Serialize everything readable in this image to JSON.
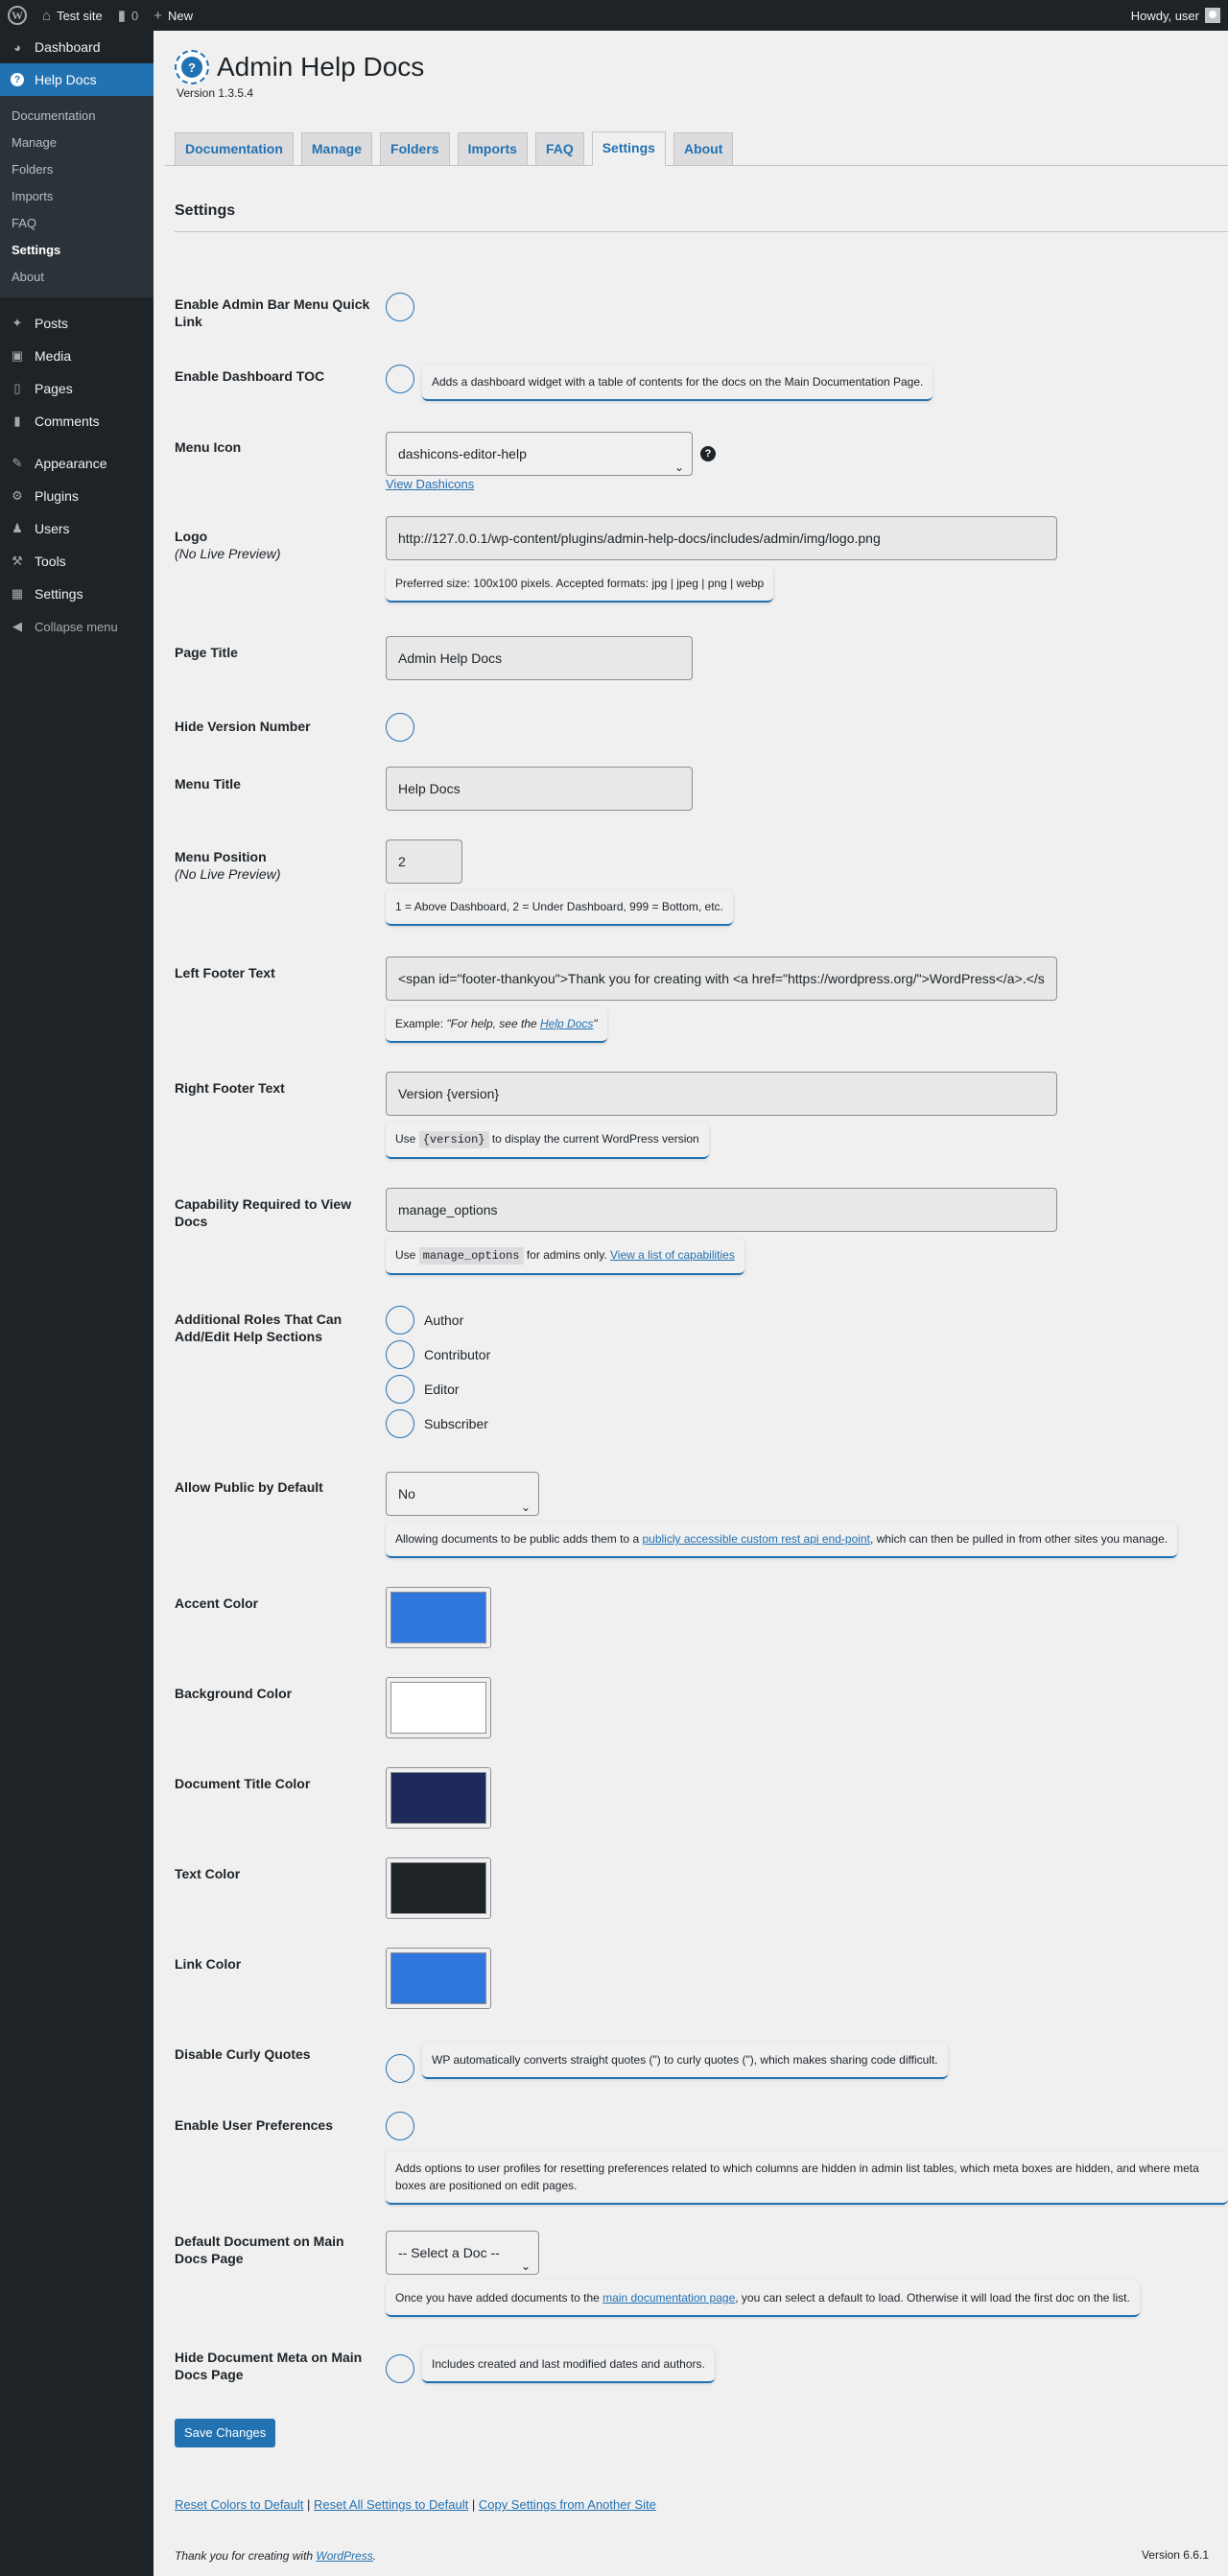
{
  "adminbar": {
    "site_name": "Test site",
    "comments_count": "0",
    "new_label": "New",
    "howdy": "Howdy, user"
  },
  "sidebar": {
    "items_top": [
      {
        "label": "Dashboard",
        "icon": "dashboard-icon"
      },
      {
        "label": "Help Docs",
        "icon": "help-icon"
      }
    ],
    "submenu": [
      "Documentation",
      "Manage",
      "Folders",
      "Imports",
      "FAQ",
      "Settings",
      "About"
    ],
    "items_mid": [
      {
        "label": "Posts",
        "icon": "pin-icon"
      },
      {
        "label": "Media",
        "icon": "media-icon"
      },
      {
        "label": "Pages",
        "icon": "pages-icon"
      },
      {
        "label": "Comments",
        "icon": "comments-icon"
      }
    ],
    "items_bottom": [
      {
        "label": "Appearance",
        "icon": "brush-icon"
      },
      {
        "label": "Plugins",
        "icon": "plugin-icon"
      },
      {
        "label": "Users",
        "icon": "users-icon"
      },
      {
        "label": "Tools",
        "icon": "wrench-icon"
      },
      {
        "label": "Settings",
        "icon": "settings-icon"
      }
    ],
    "collapse": "Collapse menu"
  },
  "header": {
    "title": "Admin Help Docs",
    "version": "Version 1.3.5.4"
  },
  "tabs": [
    "Documentation",
    "Manage",
    "Folders",
    "Imports",
    "FAQ",
    "Settings",
    "About"
  ],
  "section_title": "Settings",
  "settings": {
    "admin_bar": {
      "label": "Enable Admin Bar Menu Quick Link"
    },
    "dashboard_toc": {
      "label": "Enable Dashboard TOC",
      "help": "Adds a dashboard widget with a table of contents for the docs on the Main Documentation Page."
    },
    "menu_icon": {
      "label": "Menu Icon",
      "value": "dashicons-editor-help",
      "link": "View Dashicons"
    },
    "logo": {
      "label": "Logo",
      "sub": "(No Live Preview)",
      "value": "http://127.0.0.1/wp-content/plugins/admin-help-docs/includes/admin/img/logo.png",
      "help": "Preferred size: 100x100 pixels. Accepted formats: jpg | jpeg | png | webp"
    },
    "page_title": {
      "label": "Page Title",
      "value": "Admin Help Docs"
    },
    "hide_version": {
      "label": "Hide Version Number"
    },
    "menu_title": {
      "label": "Menu Title",
      "value": "Help Docs"
    },
    "menu_position": {
      "label": "Menu Position",
      "sub": "(No Live Preview)",
      "value": "2",
      "help": "1 = Above Dashboard, 2 = Under Dashboard, 999 = Bottom, etc."
    },
    "left_footer": {
      "label": "Left Footer Text",
      "value": "<span id=\"footer-thankyou\">Thank you for creating with <a href=\"https://wordpress.org/\">WordPress</a>.</s",
      "help_prefix": "Example: ",
      "help_quote_a": "\"For help, see the ",
      "help_link": "Help Docs",
      "help_quote_b": "\""
    },
    "right_footer": {
      "label": "Right Footer Text",
      "value": "Version {version}",
      "help_a": "Use ",
      "help_code": "{version}",
      "help_b": " to display the current WordPress version"
    },
    "capability": {
      "label": "Capability Required to View Docs",
      "value": "manage_options",
      "help_a": "Use ",
      "help_code": "manage_options",
      "help_b": " for admins only. ",
      "help_link": "View a list of capabilities"
    },
    "roles": {
      "label": "Additional Roles That Can Add/Edit Help Sections",
      "options": [
        "Author",
        "Contributor",
        "Editor",
        "Subscriber"
      ]
    },
    "allow_public": {
      "label": "Allow Public by Default",
      "value": "No",
      "help_a": "Allowing documents to be public adds them to a ",
      "help_link": "publicly accessible custom rest api end-point",
      "help_b": ", which can then be pulled in from other sites you manage."
    },
    "accent_color": {
      "label": "Accent Color",
      "color": "#2f77dc"
    },
    "background_color": {
      "label": "Background Color",
      "color": "#ffffff"
    },
    "doc_title_color": {
      "label": "Document Title Color",
      "color": "#1e2a5a"
    },
    "text_color": {
      "label": "Text Color",
      "color": "#1d2327"
    },
    "link_color": {
      "label": "Link Color",
      "color": "#2f77dc"
    },
    "curly_quotes": {
      "label": "Disable Curly Quotes",
      "help": "WP automatically converts straight quotes (\") to curly quotes (\"), which makes sharing code difficult."
    },
    "user_prefs": {
      "label": "Enable User Preferences",
      "help": "Adds options to user profiles for resetting preferences related to which columns are hidden in admin list tables, which meta boxes are hidden, and where meta boxes are positioned on edit pages."
    },
    "default_doc": {
      "label": "Default Document on Main Docs Page",
      "value": "-- Select a Doc --",
      "help_a": "Once you have added documents to the ",
      "help_link": "main documentation page",
      "help_b": ", you can select a default to load. Otherwise it will load the first doc on the list."
    },
    "hide_meta": {
      "label": "Hide Document Meta on Main Docs Page",
      "help": "Includes created and last modified dates and authors."
    }
  },
  "save_button": "Save Changes",
  "footer_links": {
    "reset_colors": "Reset Colors to Default",
    "reset_all": "Reset All Settings to Default",
    "copy_settings": "Copy Settings from Another Site",
    "sep": "|"
  },
  "wp_footer": {
    "left_a": "Thank you for creating with ",
    "left_link": "WordPress",
    "left_b": ".",
    "right": "Version 6.6.1"
  }
}
